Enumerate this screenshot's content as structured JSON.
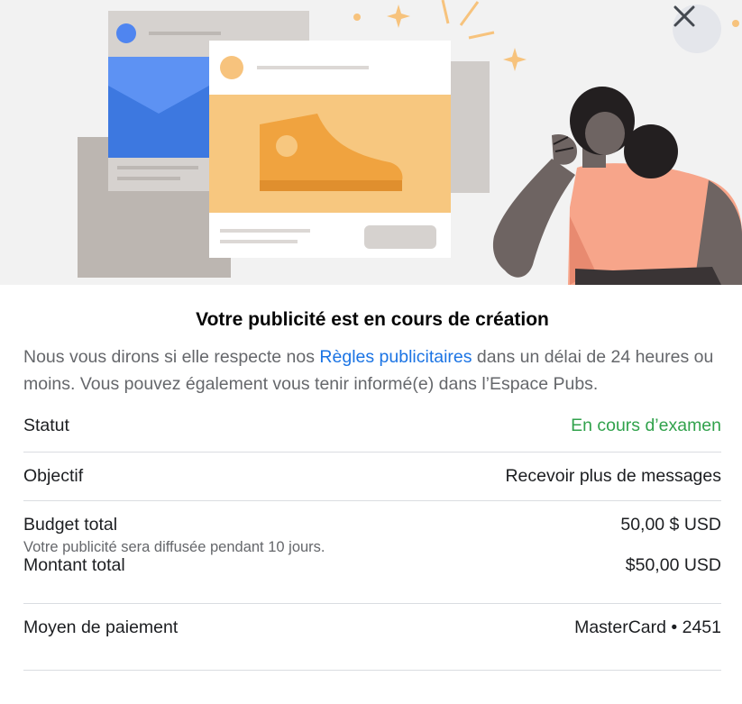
{
  "header": {
    "close_icon": "close-icon"
  },
  "main": {
    "title": "Votre publicité est en cours de création",
    "description": {
      "before_link": "Nous vous dirons si elle respecte nos ",
      "link": "Règles publicitaires",
      "after_link": " dans un délai de 24 heures ou moins. Vous pouvez également vous tenir informé(e) dans l’Espace Pubs."
    }
  },
  "details": {
    "status": {
      "label": "Statut",
      "value": "En cours d’examen"
    },
    "objective": {
      "label": "Objectif",
      "value": "Recevoir plus de messages"
    },
    "budget": {
      "label": "Budget total",
      "value": "50,00 $ USD",
      "note": "Votre publicité sera diffusée pendant 10 jours."
    },
    "amount": {
      "label": "Montant total",
      "value": "$50,00 USD"
    },
    "payment": {
      "label": "Moyen de paiement",
      "value": "MasterCard • 2451"
    }
  },
  "colors": {
    "accent_link": "#1b74e4",
    "status_green": "#31a24c",
    "hero_background": "#f2f2f2"
  }
}
